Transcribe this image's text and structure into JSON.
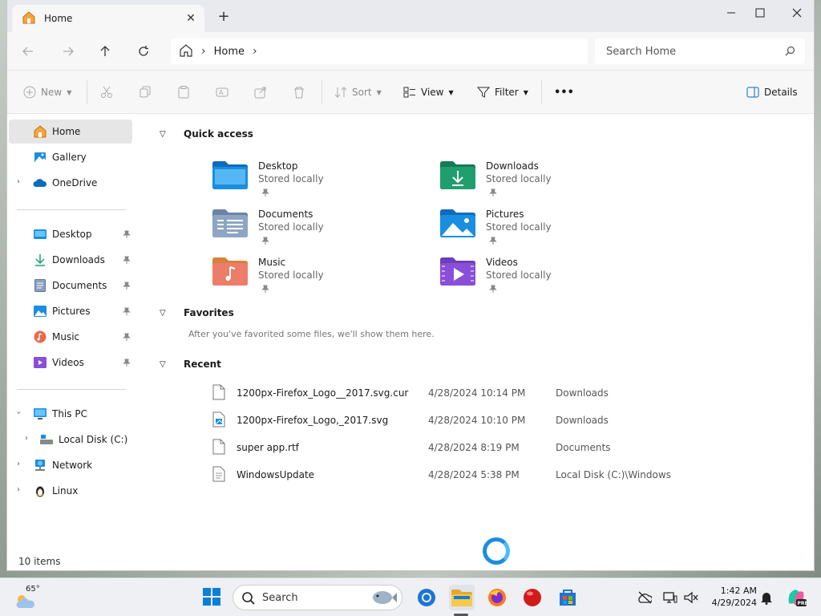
{
  "window": {
    "tab_title": "Home",
    "new_tab": "+"
  },
  "address": {
    "breadcrumb": [
      "Home"
    ],
    "search_placeholder": "Search Home"
  },
  "command_bar": {
    "new_label": "New",
    "sort_label": "Sort",
    "view_label": "View",
    "filter_label": "Filter",
    "more_label": "•••",
    "details_label": "Details"
  },
  "sidebar": {
    "top": [
      {
        "label": "Home",
        "icon": "home-icon"
      },
      {
        "label": "Gallery",
        "icon": "gallery-icon"
      },
      {
        "label": "OneDrive",
        "icon": "onedrive-icon"
      }
    ],
    "pinned": [
      {
        "label": "Desktop",
        "icon": "desktop-folder-icon"
      },
      {
        "label": "Downloads",
        "icon": "download-icon"
      },
      {
        "label": "Documents",
        "icon": "documents-icon"
      },
      {
        "label": "Pictures",
        "icon": "pictures-icon"
      },
      {
        "label": "Music",
        "icon": "music-icon"
      },
      {
        "label": "Videos",
        "icon": "videos-icon"
      }
    ],
    "drives": [
      {
        "label": "This PC",
        "icon": "pc-icon"
      },
      {
        "label": "Local Disk (C:)",
        "icon": "disk-icon"
      },
      {
        "label": "Network",
        "icon": "network-icon"
      },
      {
        "label": "Linux",
        "icon": "linux-icon"
      }
    ]
  },
  "status": {
    "item_count": "10 items"
  },
  "main": {
    "quick_access_title": "Quick access",
    "quick_access": [
      {
        "name": "Desktop",
        "sub": "Stored locally"
      },
      {
        "name": "Downloads",
        "sub": "Stored locally"
      },
      {
        "name": "Documents",
        "sub": "Stored locally"
      },
      {
        "name": "Pictures",
        "sub": "Stored locally"
      },
      {
        "name": "Music",
        "sub": "Stored locally"
      },
      {
        "name": "Videos",
        "sub": "Stored locally"
      }
    ],
    "favorites_title": "Favorites",
    "favorites_empty": "After you've favorited some files, we'll show them here.",
    "recent_title": "Recent",
    "recent": [
      {
        "name": "1200px-Firefox_Logo__2017.svg.cur",
        "date": "4/28/2024 10:14 PM",
        "location": "Downloads"
      },
      {
        "name": "1200px-Firefox_Logo,_2017.svg",
        "date": "4/28/2024 10:10 PM",
        "location": "Downloads"
      },
      {
        "name": "super app.rtf",
        "date": "4/28/2024 8:19 PM",
        "location": "Documents"
      },
      {
        "name": "WindowsUpdate",
        "date": "4/28/2024 5:38 PM",
        "location": "Local Disk (C:)\\Windows"
      }
    ]
  },
  "taskbar": {
    "temperature": "65°",
    "search_label": "Search",
    "time": "1:42 AM",
    "date": "4/29/2024"
  },
  "colors": {
    "accent": "#0067c0",
    "folder_blue": "#1a8ee0",
    "downloads_green": "#1f9e6e"
  }
}
